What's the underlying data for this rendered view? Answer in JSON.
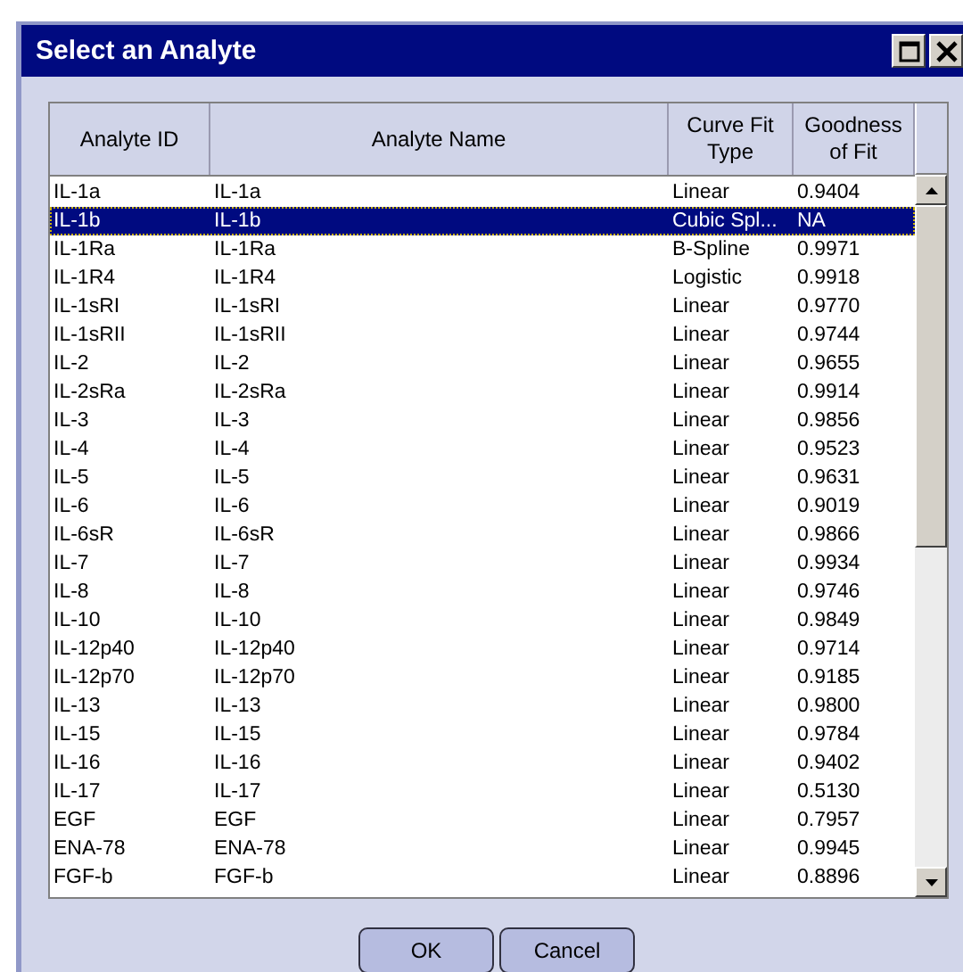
{
  "window": {
    "title": "Select an Analyte"
  },
  "table": {
    "columns": [
      "Analyte ID",
      "Analyte Name",
      "Curve Fit Type",
      "Goodness of Fit"
    ],
    "rows": [
      {
        "id": "IL-1a",
        "name": "IL-1a",
        "fit": "Linear",
        "goodness": "0.9404",
        "selected": false
      },
      {
        "id": "IL-1b",
        "name": "IL-1b",
        "fit": "Cubic Spl...",
        "goodness": "NA",
        "selected": true
      },
      {
        "id": "IL-1Ra",
        "name": "IL-1Ra",
        "fit": "B-Spline",
        "goodness": "0.9971",
        "selected": false
      },
      {
        "id": "IL-1R4",
        "name": "IL-1R4",
        "fit": "Logistic",
        "goodness": "0.9918",
        "selected": false
      },
      {
        "id": "IL-1sRI",
        "name": "IL-1sRI",
        "fit": "Linear",
        "goodness": "0.9770",
        "selected": false
      },
      {
        "id": "IL-1sRII",
        "name": "IL-1sRII",
        "fit": "Linear",
        "goodness": "0.9744",
        "selected": false
      },
      {
        "id": "IL-2",
        "name": "IL-2",
        "fit": "Linear",
        "goodness": "0.9655",
        "selected": false
      },
      {
        "id": "IL-2sRa",
        "name": "IL-2sRa",
        "fit": "Linear",
        "goodness": "0.9914",
        "selected": false
      },
      {
        "id": "IL-3",
        "name": "IL-3",
        "fit": "Linear",
        "goodness": "0.9856",
        "selected": false
      },
      {
        "id": "IL-4",
        "name": "IL-4",
        "fit": "Linear",
        "goodness": "0.9523",
        "selected": false
      },
      {
        "id": "IL-5",
        "name": "IL-5",
        "fit": "Linear",
        "goodness": "0.9631",
        "selected": false
      },
      {
        "id": "IL-6",
        "name": "IL-6",
        "fit": "Linear",
        "goodness": "0.9019",
        "selected": false
      },
      {
        "id": "IL-6sR",
        "name": "IL-6sR",
        "fit": "Linear",
        "goodness": "0.9866",
        "selected": false
      },
      {
        "id": "IL-7",
        "name": "IL-7",
        "fit": "Linear",
        "goodness": "0.9934",
        "selected": false
      },
      {
        "id": "IL-8",
        "name": "IL-8",
        "fit": "Linear",
        "goodness": "0.9746",
        "selected": false
      },
      {
        "id": "IL-10",
        "name": "IL-10",
        "fit": "Linear",
        "goodness": "0.9849",
        "selected": false
      },
      {
        "id": "IL-12p40",
        "name": "IL-12p40",
        "fit": "Linear",
        "goodness": "0.9714",
        "selected": false
      },
      {
        "id": "IL-12p70",
        "name": "IL-12p70",
        "fit": "Linear",
        "goodness": "0.9185",
        "selected": false
      },
      {
        "id": "IL-13",
        "name": "IL-13",
        "fit": "Linear",
        "goodness": "0.9800",
        "selected": false
      },
      {
        "id": "IL-15",
        "name": "IL-15",
        "fit": "Linear",
        "goodness": "0.9784",
        "selected": false
      },
      {
        "id": "IL-16",
        "name": "IL-16",
        "fit": "Linear",
        "goodness": "0.9402",
        "selected": false
      },
      {
        "id": "IL-17",
        "name": "IL-17",
        "fit": "Linear",
        "goodness": "0.5130",
        "selected": false
      },
      {
        "id": "EGF",
        "name": "EGF",
        "fit": "Linear",
        "goodness": "0.7957",
        "selected": false
      },
      {
        "id": "ENA-78",
        "name": "ENA-78",
        "fit": "Linear",
        "goodness": "0.9945",
        "selected": false
      },
      {
        "id": "FGF-b",
        "name": "FGF-b",
        "fit": "Linear",
        "goodness": "0.8896",
        "selected": false
      }
    ]
  },
  "buttons": [
    "OK",
    "Cancel"
  ]
}
